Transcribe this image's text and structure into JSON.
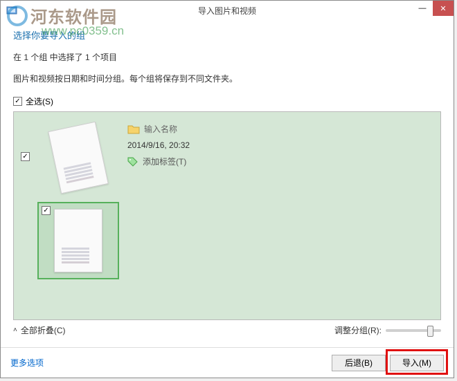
{
  "watermark": {
    "site_name": "河东软件园",
    "url": "www.pc0359.cn"
  },
  "titlebar": {
    "title": "导入图片和视频"
  },
  "content": {
    "heading": "选择你要导入的组",
    "selection_summary": "在 1 个组 中选择了 1 个项目",
    "description": "图片和视频按日期和时间分组。每个组将保存到不同文件夹。",
    "select_all_label": "全选(S)"
  },
  "group": {
    "name_placeholder": "输入名称",
    "datetime": "2014/9/16, 20:32",
    "add_tag_label": "添加标签(T)"
  },
  "bottom": {
    "collapse_all": "全部折叠(C)",
    "adjust_grouping": "调整分组(R):"
  },
  "footer": {
    "more_options": "更多选项",
    "back_btn": "后退(B)",
    "import_btn": "导入(M)"
  }
}
